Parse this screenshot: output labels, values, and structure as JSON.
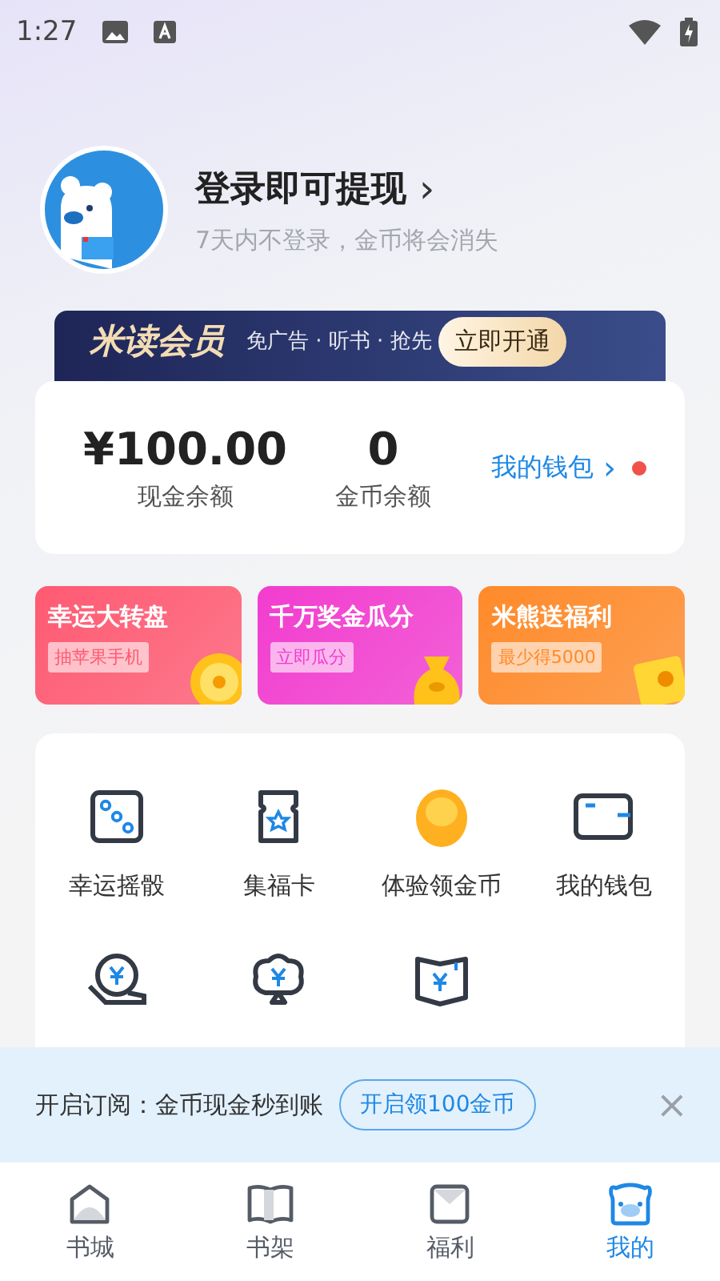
{
  "status_bar": {
    "time": "1:27"
  },
  "profile": {
    "title": "登录即可提现",
    "chevron": "›",
    "subtitle": "7天内不登录，金币将会消失"
  },
  "member_banner": {
    "brand": "米读会员",
    "perks": "免广告 · 听书 · 抢先",
    "button": "立即开通"
  },
  "wallet": {
    "balances": [
      {
        "value": "¥100.00",
        "label": "现金余额"
      },
      {
        "value": "0",
        "label": "金币余额"
      }
    ],
    "link": "我的钱包",
    "chevron": "›",
    "notice_dot": true
  },
  "promos": [
    {
      "kind": "wheel",
      "title": "幸运大转盘",
      "tag": "抽苹果手机",
      "color": "#ff5a72"
    },
    {
      "kind": "bag",
      "title": "千万奖金瓜分",
      "tag": "立即瓜分",
      "color": "#f23ccf"
    },
    {
      "kind": "envelope",
      "title": "米熊送福利",
      "tag": "最少得5000",
      "color": "#ff8a2a"
    }
  ],
  "features": [
    {
      "kind": "dice",
      "label": "幸运摇骰"
    },
    {
      "kind": "card",
      "label": "集福卡"
    },
    {
      "kind": "egg",
      "label": "体验领金币"
    },
    {
      "kind": "wallet",
      "label": "我的钱包"
    },
    {
      "kind": "coin-hand"
    },
    {
      "kind": "tree"
    },
    {
      "kind": "book"
    }
  ],
  "subscribe_bar": {
    "text": "开启订阅：金币现金秒到账",
    "button": "开启领100金币",
    "close": "×"
  },
  "tabs": [
    {
      "kind": "home",
      "label": "书城",
      "selected": false
    },
    {
      "kind": "shelf",
      "label": "书架",
      "selected": false
    },
    {
      "kind": "mail",
      "label": "福利",
      "selected": false
    },
    {
      "kind": "bear",
      "label": "我的",
      "selected": true
    }
  ]
}
